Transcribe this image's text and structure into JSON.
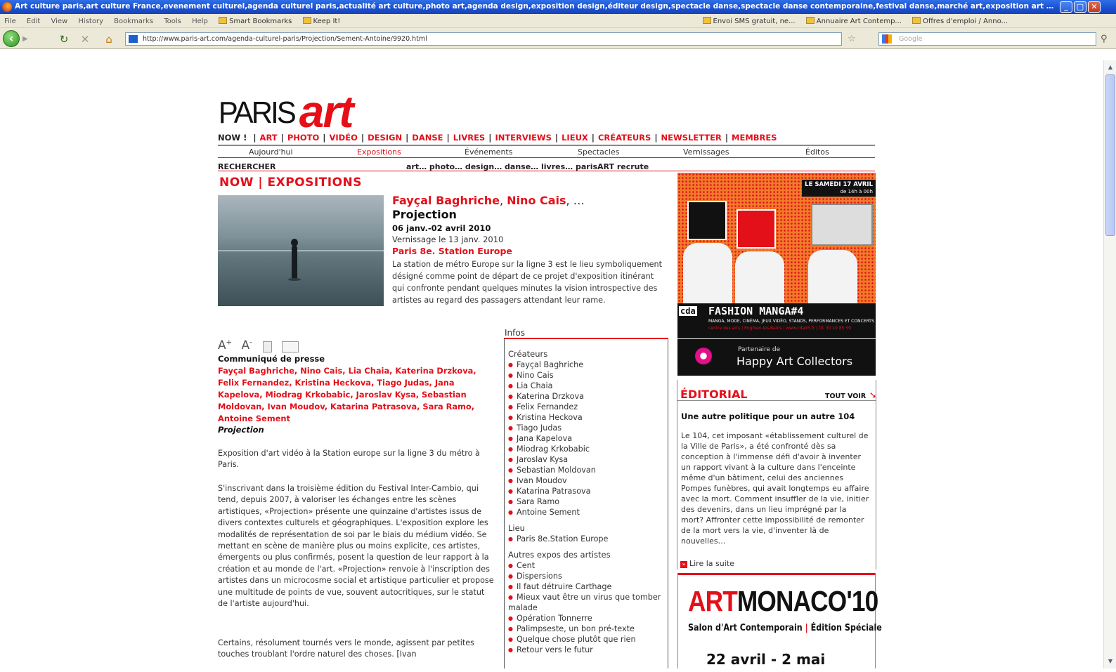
{
  "browser": {
    "window_title": "Art culture paris,art culture France,evenement culturel,agenda culturel paris,actualité art culture,photo art,agenda design,exposition design,éditeur design,spectacle danse,spectacle danse contemporaine,festival danse,marché art,exposition art cont...",
    "menu": [
      "File",
      "Edit",
      "View",
      "History",
      "Bookmarks",
      "Tools",
      "Help"
    ],
    "bookmarks": [
      "Smart Bookmarks",
      "Keep It!",
      "Envoi SMS gratuit, ne...",
      "Annuaire Art Contemp...",
      "Offres d'emploi / Anno..."
    ],
    "url": "http://www.paris-art.com/agenda-culturel-paris/Projection/Sement-Antoine/9920.html",
    "search_placeholder": "Google"
  },
  "site": {
    "logo_paris": "PARIS",
    "logo_art": "art",
    "main_nav": [
      "NOW ! ",
      "ART",
      "PHOTO",
      "VIDÉO",
      "DESIGN",
      "DANSE",
      "LIVRES",
      "INTERVIEWS",
      "LIEUX",
      "CRÉATEURS",
      "NEWSLETTER",
      "MEMBRES"
    ],
    "sub_nav": [
      "Aujourd'hui",
      "Expositions",
      "Événements",
      "Spectacles",
      "Vernissages",
      "Éditos"
    ],
    "search_label": "RECHERCHER",
    "tagline": "art… photo… design… danse… livres… parisART recrute"
  },
  "section_title": "NOW | EXPOSITIONS",
  "event": {
    "artist1": "Fayçal Baghriche",
    "artist2": "Nino Cais",
    "more": ", …",
    "title": "Projection",
    "dates": "06 janv.-02 avril 2010",
    "vernissage": "Vernissage le 13 janv. 2010",
    "venue": "Paris 8e. Station Europe",
    "description": "La station de métro Europe sur la ligne 3 est le lieu symboliquement désigné comme point de départ de ce projet d'exposition itinérant qui confronte pendant quelques minutes la vision introspective des artistes au regard des passagers attendant leur rame."
  },
  "press": {
    "heading": "Communiqué de presse",
    "artists": "Fayçal Baghriche, Nino Cais, Lia Chaia, Katerina Drzkova, Felix Fernandez, Kristina Heckova, Tiago Judas, Jana Kapelova, Miodrag Krkobabic, Jaroslav Kysa, Sebastian Moldovan, Ivan Moudov, Katarina Patrasova, Sara Ramo, Antoine Sement",
    "title": "Projection",
    "para1": "Exposition d'art vidéo à la Station europe sur la ligne 3 du métro à Paris.",
    "para2": "S'inscrivant dans la troisième édition du Festival Inter-Cambio, qui tend, depuis 2007, à valoriser les échanges entre les scènes artistiques, «Projection» présente une quinzaine d'artistes issus de divers contextes culturels et géographiques. L'exposition explore les modalités de représentation de soi par le biais du médium vidéo. Se mettant en scène de manière plus ou moins explicite, ces artistes, émergents ou plus confirmés, posent la question de leur rapport à la création et au monde de l'art. «Projection» renvoie à l'inscription des artistes dans un microcosme social et artistique particulier et propose une multitude de points de vue, souvent autocritiques, sur le statut de l'artiste aujourd'hui.",
    "para3": "Certains, résolument tournés vers le monde, agissent par petites touches troublant l'ordre naturel des choses. [Ivan"
  },
  "infos": {
    "label": "Infos",
    "createurs_heading": "Créateurs",
    "createurs": [
      "Fayçal Baghriche",
      "Nino Cais",
      "Lia Chaia",
      "Katerina Drzkova",
      "Felix Fernandez",
      "Kristina Heckova",
      "Tiago Judas",
      "Jana Kapelova",
      "Miodrag Krkobabic",
      "Jaroslav Kysa",
      "Sebastian Moldovan",
      "Ivan Moudov",
      "Katarina Patrasova",
      "Sara Ramo",
      "Antoine Sement"
    ],
    "lieu_heading": "Lieu",
    "lieu": "Paris 8e.Station Europe",
    "autres_heading": "Autres expos des artistes",
    "autres": [
      "Cent",
      "Dispersions",
      "Il faut détruire Carthage",
      "Mieux vaut être un virus que tomber malade",
      "Opération Tonnerre",
      "Palimpseste, un bon pré-texte",
      "Quelque chose plutôt que rien",
      "Retour vers le futur"
    ]
  },
  "ads": {
    "manga_date": "LE SAMEDI 17 AVRIL",
    "manga_hours": "de 14h à 00h",
    "manga_brand": "cda",
    "manga_title": "FASHION MANGA#4",
    "manga_sub": "MANGA, MODE, CINÉMA, JEUX VIDÉO, STANDS, PERFORMANCES ET CONCERTS",
    "manga_sub2": "centre des arts | Enghien-les-Bains | www.cda95.fr | 01 30 10 85 59",
    "happy_small": "Partenaire de",
    "happy_big": "Happy Art Collectors",
    "monaco_red": "ART",
    "monaco_black": "MONACO'10",
    "monaco_sub_left": "Salon d'Art Contemporain",
    "monaco_sub_right": "Édition Spéciale",
    "monaco_date": "22 avril - 2 mai"
  },
  "editorial": {
    "title": "ÉDITORIAL",
    "voir": "TOUT VOIR",
    "headline": "Une autre politique pour un autre 104",
    "text": "Le 104, cet imposant «établissement culturel de la Ville de Paris», a été confronté dès sa conception à l'immense défi d'avoir à inventer un rapport vivant à la culture dans l'enceinte même d'un bâtiment, celui des anciennes Pompes funèbres, qui avait longtemps eu affaire avec la mort. Comment insuffler de la vie, initier des devenirs, dans un lieu imprégné par la mort? Affronter cette impossibilité de remonter de la mort vers la vie, d'inventer là de nouvelles…",
    "more": "Lire la suite"
  }
}
